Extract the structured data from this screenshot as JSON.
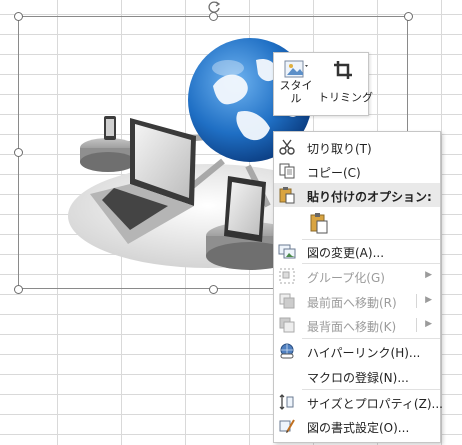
{
  "mini_toolbar": {
    "style_label": "スタイル",
    "trim_label": "トリミング"
  },
  "context_menu": {
    "items": [
      {
        "label": "切り取り(T)",
        "icon": "scissors-icon",
        "enabled": true
      },
      {
        "label": "コピー(C)",
        "icon": "copy-icon",
        "enabled": true
      },
      {
        "label": "貼り付けのオプション:",
        "icon": "paste-icon",
        "enabled": true
      },
      {
        "label": "図の変更(A)...",
        "icon": "change-picture-icon",
        "enabled": true
      },
      {
        "label": "グループ化(G)",
        "icon": "group-icon",
        "enabled": false
      },
      {
        "label": "最前面へ移動(R)",
        "icon": "bring-to-front-icon",
        "enabled": false
      },
      {
        "label": "最背面へ移動(K)",
        "icon": "send-to-back-icon",
        "enabled": false
      },
      {
        "label": "ハイパーリンク(H)...",
        "icon": "hyperlink-icon",
        "enabled": true
      },
      {
        "label": "マクロの登録(N)...",
        "icon": "",
        "enabled": true
      },
      {
        "label": "サイズとプロパティ(Z)...",
        "icon": "size-properties-icon",
        "enabled": true
      },
      {
        "label": "図の書式設定(O)...",
        "icon": "format-picture-icon",
        "enabled": true
      }
    ],
    "submenu_arrow": "▶"
  },
  "colors": {
    "grid_line": "#d9d9d9",
    "globe_blue": "#1f6fc4",
    "menu_header_bg": "#e9e9e9",
    "disabled_text": "#9b9b9b"
  }
}
